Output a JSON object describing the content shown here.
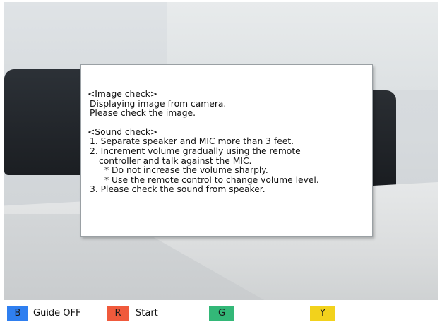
{
  "dialog": {
    "image_check_title": "<Image check>",
    "image_check_lines": [
      "Displaying image from camera.",
      "Please check the image."
    ],
    "sound_check_title": "<Sound check>",
    "sound_check_lines": [
      "1. Separate speaker and MIC more than 3 feet.",
      "2. Increment volume gradually using the remote",
      "controller and talk against the MIC.",
      "* Do not increase the volume sharply.",
      "* Use the remote control to change volume level.",
      "3. Please check the sound from speaker."
    ]
  },
  "bottom_bar": {
    "keys": [
      {
        "letter": "B",
        "label": "Guide OFF",
        "color": "#2f7ff0"
      },
      {
        "letter": "R",
        "label": "Start",
        "color": "#f05a3c"
      },
      {
        "letter": "G",
        "label": "",
        "color": "#33b878"
      },
      {
        "letter": "Y",
        "label": "",
        "color": "#f2d21c"
      }
    ]
  }
}
